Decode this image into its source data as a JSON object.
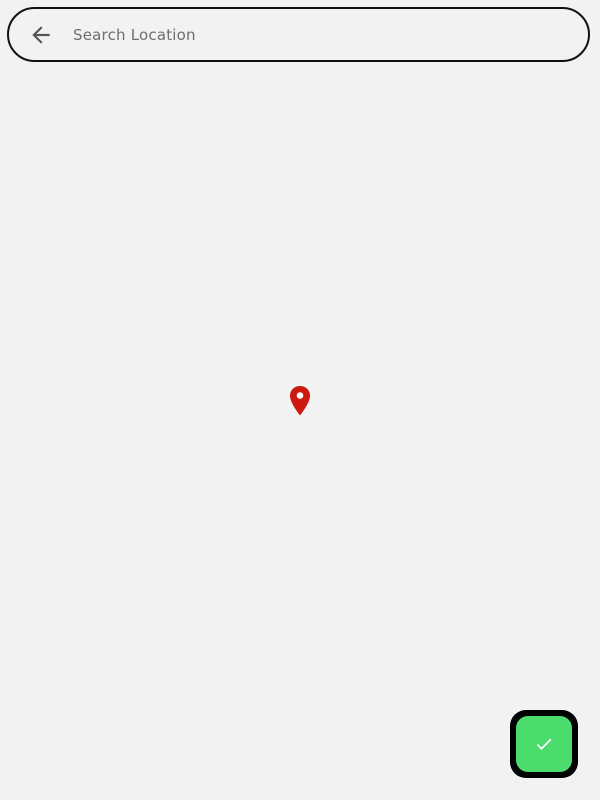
{
  "search": {
    "placeholder": "Search Location",
    "value": ""
  },
  "icons": {
    "back": "arrow-back-icon",
    "pin": "map-pin-icon",
    "confirm": "check-icon"
  },
  "colors": {
    "background": "#f2f2f2",
    "pin": "#cc1a0e",
    "fab_background": "#4cdb6d",
    "border": "#111111"
  }
}
